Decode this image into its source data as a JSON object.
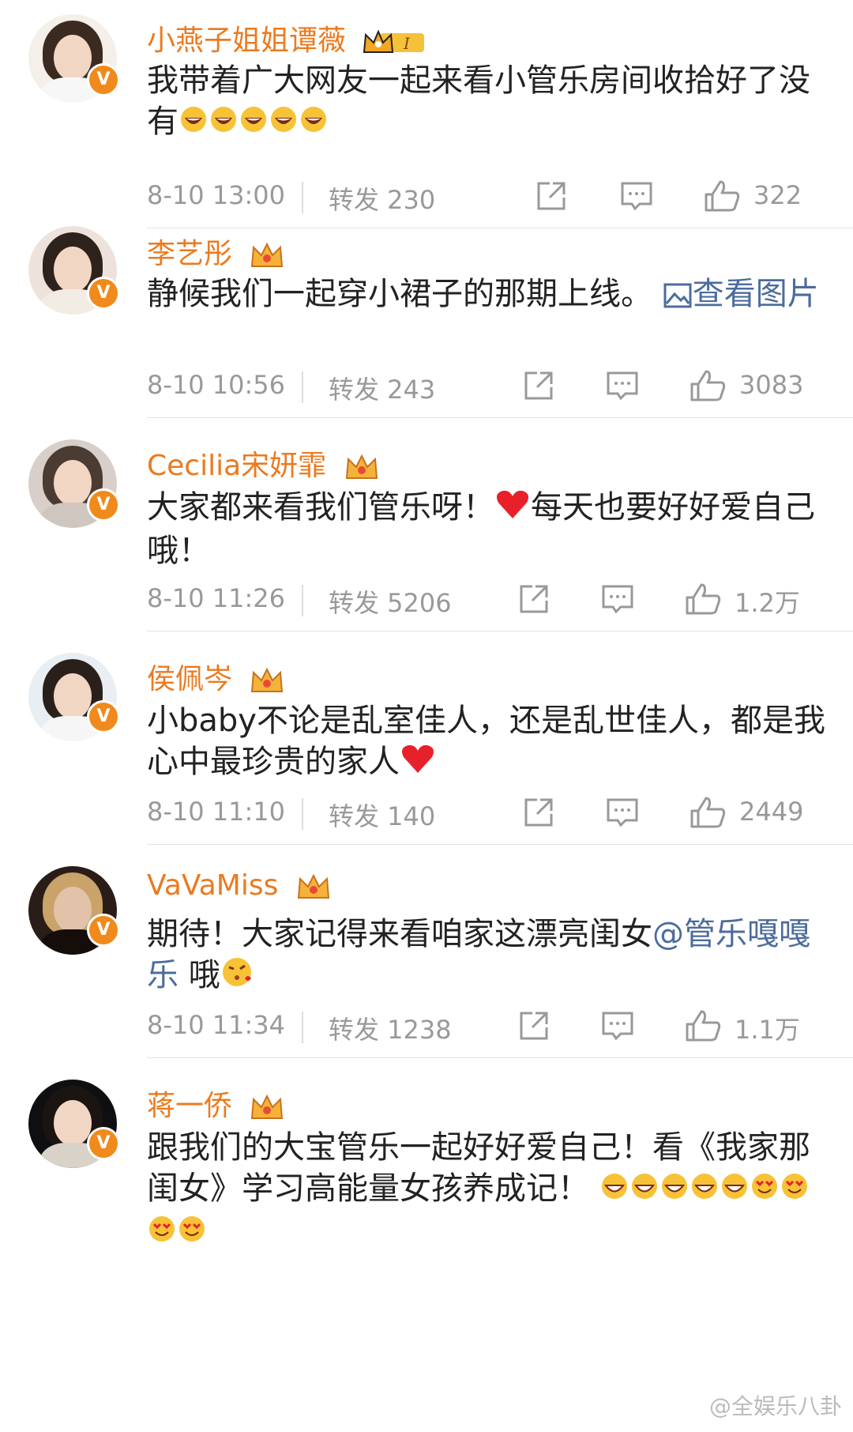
{
  "comments": [
    {
      "name": "小燕子姐姐谭薇",
      "text_main": "我带着广大网友一起来看小管乐房间收拾好了没有",
      "date": "8-10 13:00",
      "forward": "转发 230",
      "likes": "322"
    },
    {
      "name": "李艺彤",
      "text_main": "静候我们一起穿小裙子的那期上线。",
      "link": "查看图片",
      "date": "8-10 10:56",
      "forward": "转发 243",
      "likes": "3083"
    },
    {
      "name": "Cecilia宋妍霏",
      "text_main": "大家都来看我们管乐呀！",
      "text_after": "每天也要好好爱自己哦！",
      "date": "8-10 11:26",
      "forward": "转发 5206",
      "likes": "1.2万"
    },
    {
      "name": "侯佩岑",
      "text_main": "小baby不论是乱室佳人，还是乱世佳人，都是我心中最珍贵的家人",
      "date": "8-10 11:10",
      "forward": "转发 140",
      "likes": "2449"
    },
    {
      "name": "VaVaMiss",
      "text_main": "期待！大家记得来看咱家这漂亮闺女",
      "link": "@管乐嘎嘎乐",
      "text_after": " 哦",
      "date": "8-10 11:34",
      "forward": "转发 1238",
      "likes": "1.1万"
    },
    {
      "name": "蒋一侨",
      "text_main": "跟我们的大宝管乐一起好好爱自己！看《我家那闺女》学习高能量女孩养成记！"
    }
  ],
  "watermark": "@全娱乐八卦",
  "colors": {
    "name": "#eb7a1f",
    "link": "#4c6c9d",
    "badge": "#f08a1c"
  }
}
